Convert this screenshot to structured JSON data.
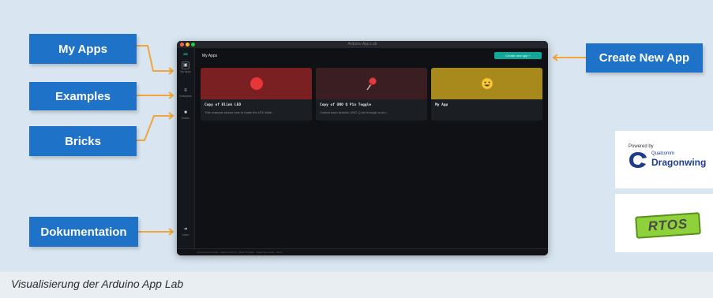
{
  "callouts": {
    "my_apps": "My Apps",
    "examples": "Examples",
    "bricks": "Bricks",
    "dokumentation": "Dokumentation",
    "create_new_app": "Create New App"
  },
  "window": {
    "title": "Arduino App Lab",
    "traffic_lights": [
      "#ff5f57",
      "#febc2e",
      "#28c840"
    ]
  },
  "sidebar": {
    "logo": "∞",
    "items": [
      {
        "label": "My Apps",
        "icon": "apps-icon"
      },
      {
        "label": "Examples",
        "icon": "examples-icon"
      },
      {
        "label": "Bricks",
        "icon": "bricks-icon"
      },
      {
        "label": "Learn",
        "icon": "learn-icon"
      }
    ]
  },
  "main": {
    "title": "My Apps",
    "create_button": "Create new app +"
  },
  "cards": [
    {
      "title": "Copy of Blink LED",
      "description": "This example shows how to make the LED blink...",
      "color": "#7a1f22",
      "icon": "red-circle-icon"
    },
    {
      "title": "Copy of UNO Q Pin Toggle",
      "description": "Control each Arduino UNO Q pin through a sou...",
      "color": "#3a1e22",
      "icon": "pin-icon"
    },
    {
      "title": "My App",
      "description": "",
      "color": "#a7891c",
      "icon": "smiley-icon"
    }
  ],
  "statusbar": {
    "text": "Connected to board  ·  Arduino UNO Q  ·  Flash firmware  ·  Board up-to-date  ·  Docs"
  },
  "logos": {
    "qualcomm_powered": "Powered by",
    "qualcomm_name": "Qualcomm",
    "qualcomm_product": "Dragonwing",
    "rtos": "RTOS"
  },
  "caption": "Visualisierung der Arduino App Lab",
  "colors": {
    "callout_blue": "#1e72c8",
    "arrow_orange": "#f0a63b",
    "accent_teal": "#13a79a"
  }
}
